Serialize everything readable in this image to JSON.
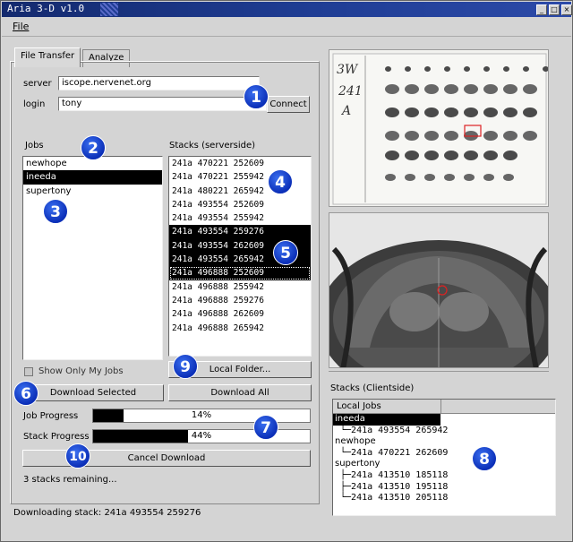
{
  "window": {
    "title": "Aria 3-D v1.0",
    "controls": [
      "_",
      "□",
      "×"
    ]
  },
  "menu": {
    "file": "File"
  },
  "tabs": [
    {
      "label": "File Transfer",
      "active": true
    },
    {
      "label": "Analyze",
      "active": false
    }
  ],
  "connection": {
    "server_label": "server",
    "server_value": "iscope.nervenet.org",
    "login_label": "login",
    "login_value": "tony",
    "connect_label": "Connect"
  },
  "jobs": {
    "label": "Jobs",
    "items": [
      "newhope",
      "ineeda",
      "supertony"
    ],
    "selected_index": 1,
    "show_only_mine_label": "Show Only My Jobs",
    "show_only_mine_checked": false
  },
  "stacks_server": {
    "label": "Stacks (serverside)",
    "items": [
      "241a 470221 252609",
      "241a 470221 255942",
      "241a 480221 265942",
      "241a 493554 252609",
      "241a 493554 255942",
      "241a 493554 259276",
      "241a 493554 262609",
      "241a 493554 265942",
      "241a 496888 252609",
      "241a 496888 255942",
      "241a 496888 259276",
      "241a 496888 262609",
      "241a 496888 265942"
    ],
    "selected_indices": [
      5,
      6,
      7,
      8
    ],
    "focused_index": 8
  },
  "buttons": {
    "local_folder": "Local Folder...",
    "download_selected": "Download Selected",
    "download_all": "Download All",
    "cancel_download": "Cancel Download"
  },
  "progress": {
    "job_label": "Job Progress",
    "job_value": 14,
    "job_text": "14%",
    "stack_label": "Stack Progress",
    "stack_value": 44,
    "stack_text": "44%"
  },
  "status": {
    "remaining": "3 stacks remaining...",
    "downloading": "Downloading stack: 241a 493554 259276"
  },
  "clientside": {
    "label": "Stacks (Clientside)",
    "column_header": "Local Jobs",
    "tree": [
      {
        "job": "ineeda",
        "selected": true,
        "children": [
          "241a 493554 265942"
        ]
      },
      {
        "job": "newhope",
        "selected": false,
        "children": [
          "241a 470221 262609"
        ]
      },
      {
        "job": "supertony",
        "selected": false,
        "children": [
          "241a 413510 185118",
          "241a 413510 195118",
          "241a 413510 205118"
        ]
      }
    ]
  },
  "preview": {
    "slide_handwriting": [
      "3W",
      "241",
      "A"
    ]
  },
  "callouts": [
    "1",
    "2",
    "3",
    "4",
    "5",
    "6",
    "7",
    "8",
    "9",
    "10"
  ],
  "colors": {
    "title_bar": "#1f3d94",
    "callout": "#0b2fb8",
    "selection": "#000000"
  }
}
